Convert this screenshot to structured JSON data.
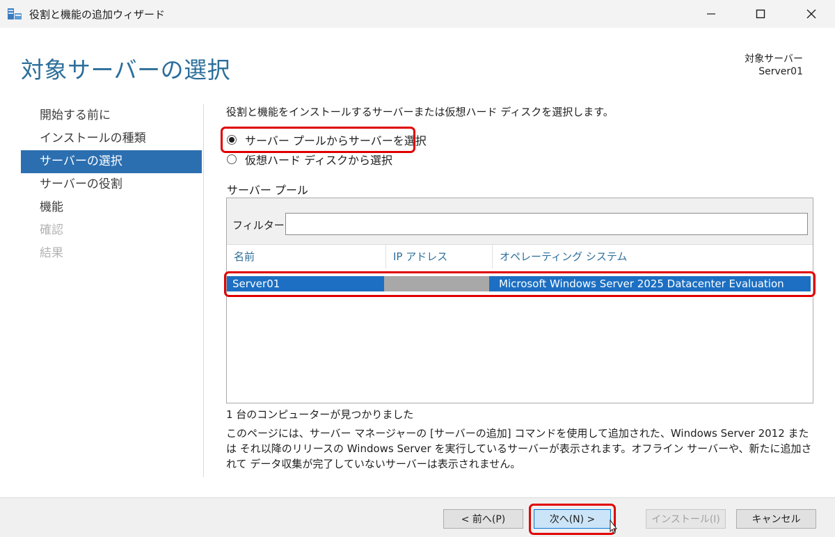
{
  "window": {
    "title": "役割と機能の追加ウィザード"
  },
  "header": {
    "heading": "対象サーバーの選択",
    "target_label": "対象サーバー",
    "target_value": "Server01"
  },
  "nav": {
    "items": [
      {
        "label": "開始する前に",
        "state": "normal"
      },
      {
        "label": "インストールの種類",
        "state": "normal"
      },
      {
        "label": "サーバーの選択",
        "state": "active"
      },
      {
        "label": "サーバーの役割",
        "state": "normal"
      },
      {
        "label": "機能",
        "state": "normal"
      },
      {
        "label": "確認",
        "state": "disabled"
      },
      {
        "label": "結果",
        "state": "disabled"
      }
    ]
  },
  "content": {
    "description": "役割と機能をインストールするサーバーまたは仮想ハード ディスクを選択します。",
    "radio_pool": "サーバー プールからサーバーを選択",
    "radio_vhd": "仮想ハード ディスクから選択",
    "section_label": "サーバー プール",
    "filter_label": "フィルター:",
    "filter_value": "",
    "columns": [
      "名前",
      "IP アドレス",
      "オペレーティング システム"
    ],
    "rows": [
      {
        "name": "Server01",
        "ip": "",
        "os": "Microsoft Windows Server 2025 Datacenter Evaluation"
      }
    ],
    "count_text": "1 台のコンピューターが見つかりました",
    "info_text": "このページには、サーバー マネージャーの [サーバーの追加] コマンドを使用して追加された、Windows Server 2012 または それ以降のリリースの Windows Server を実行しているサーバーが表示されます。オフライン サーバーや、新たに追加されて データ収集が完了していないサーバーは表示されません。"
  },
  "footer": {
    "prev": "< 前へ(P)",
    "next": "次へ(N) >",
    "install": "インストール(I)",
    "cancel": "キャンセル"
  },
  "colors": {
    "heading": "#2c6e9a",
    "nav_active": "#2b6fb0",
    "selection": "#1c6fc2",
    "highlight_box": "#e00000"
  }
}
